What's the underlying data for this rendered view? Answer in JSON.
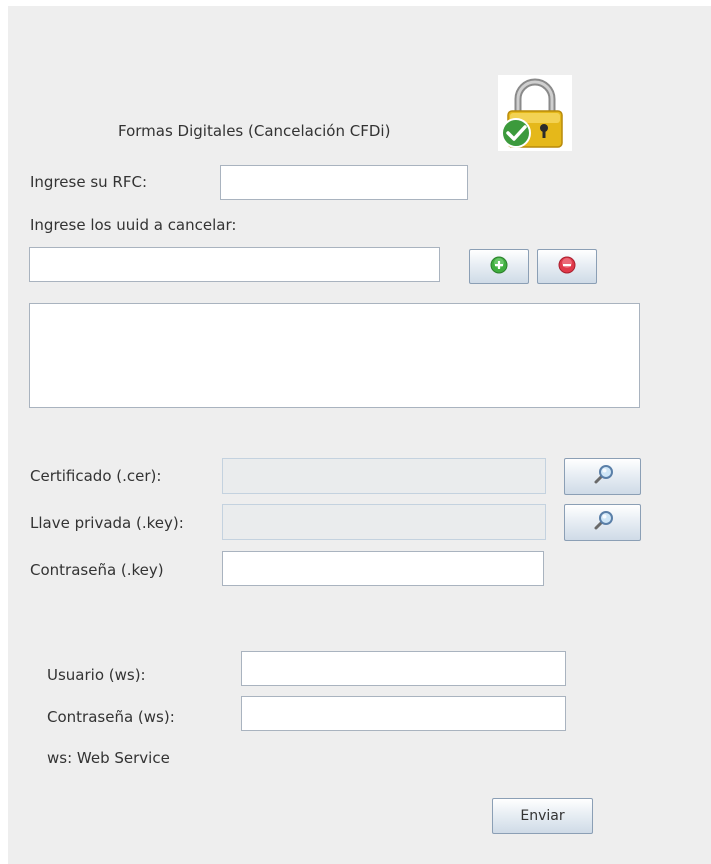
{
  "header": {
    "title": "Formas Digitales (Cancelación CFDi)",
    "lock_icon": "lock-check-icon"
  },
  "rfc": {
    "label": "Ingrese su RFC:",
    "value": ""
  },
  "uuid": {
    "label": "Ingrese los uuid a cancelar:",
    "value": "",
    "add_icon": "plus-circle-icon",
    "remove_icon": "minus-circle-icon",
    "items": []
  },
  "certificado": {
    "label": "Certificado (.cer):",
    "value": "",
    "browse_icon": "magnifier-icon"
  },
  "llave": {
    "label": "Llave privada (.key):",
    "value": "",
    "browse_icon": "magnifier-icon"
  },
  "contrasena_key": {
    "label": "Contraseña (.key)",
    "value": ""
  },
  "usuario_ws": {
    "label": "Usuario (ws):",
    "value": ""
  },
  "contrasena_ws": {
    "label": "Contraseña (ws):",
    "value": ""
  },
  "note": "ws: Web Service",
  "submit": {
    "label": "Enviar"
  },
  "colors": {
    "panel_bg": "#eeeeee",
    "add_green": "#3fae3f",
    "remove_red": "#e0394a",
    "lock_gold": "#e5b81a",
    "check_green": "#3c9a3c"
  }
}
